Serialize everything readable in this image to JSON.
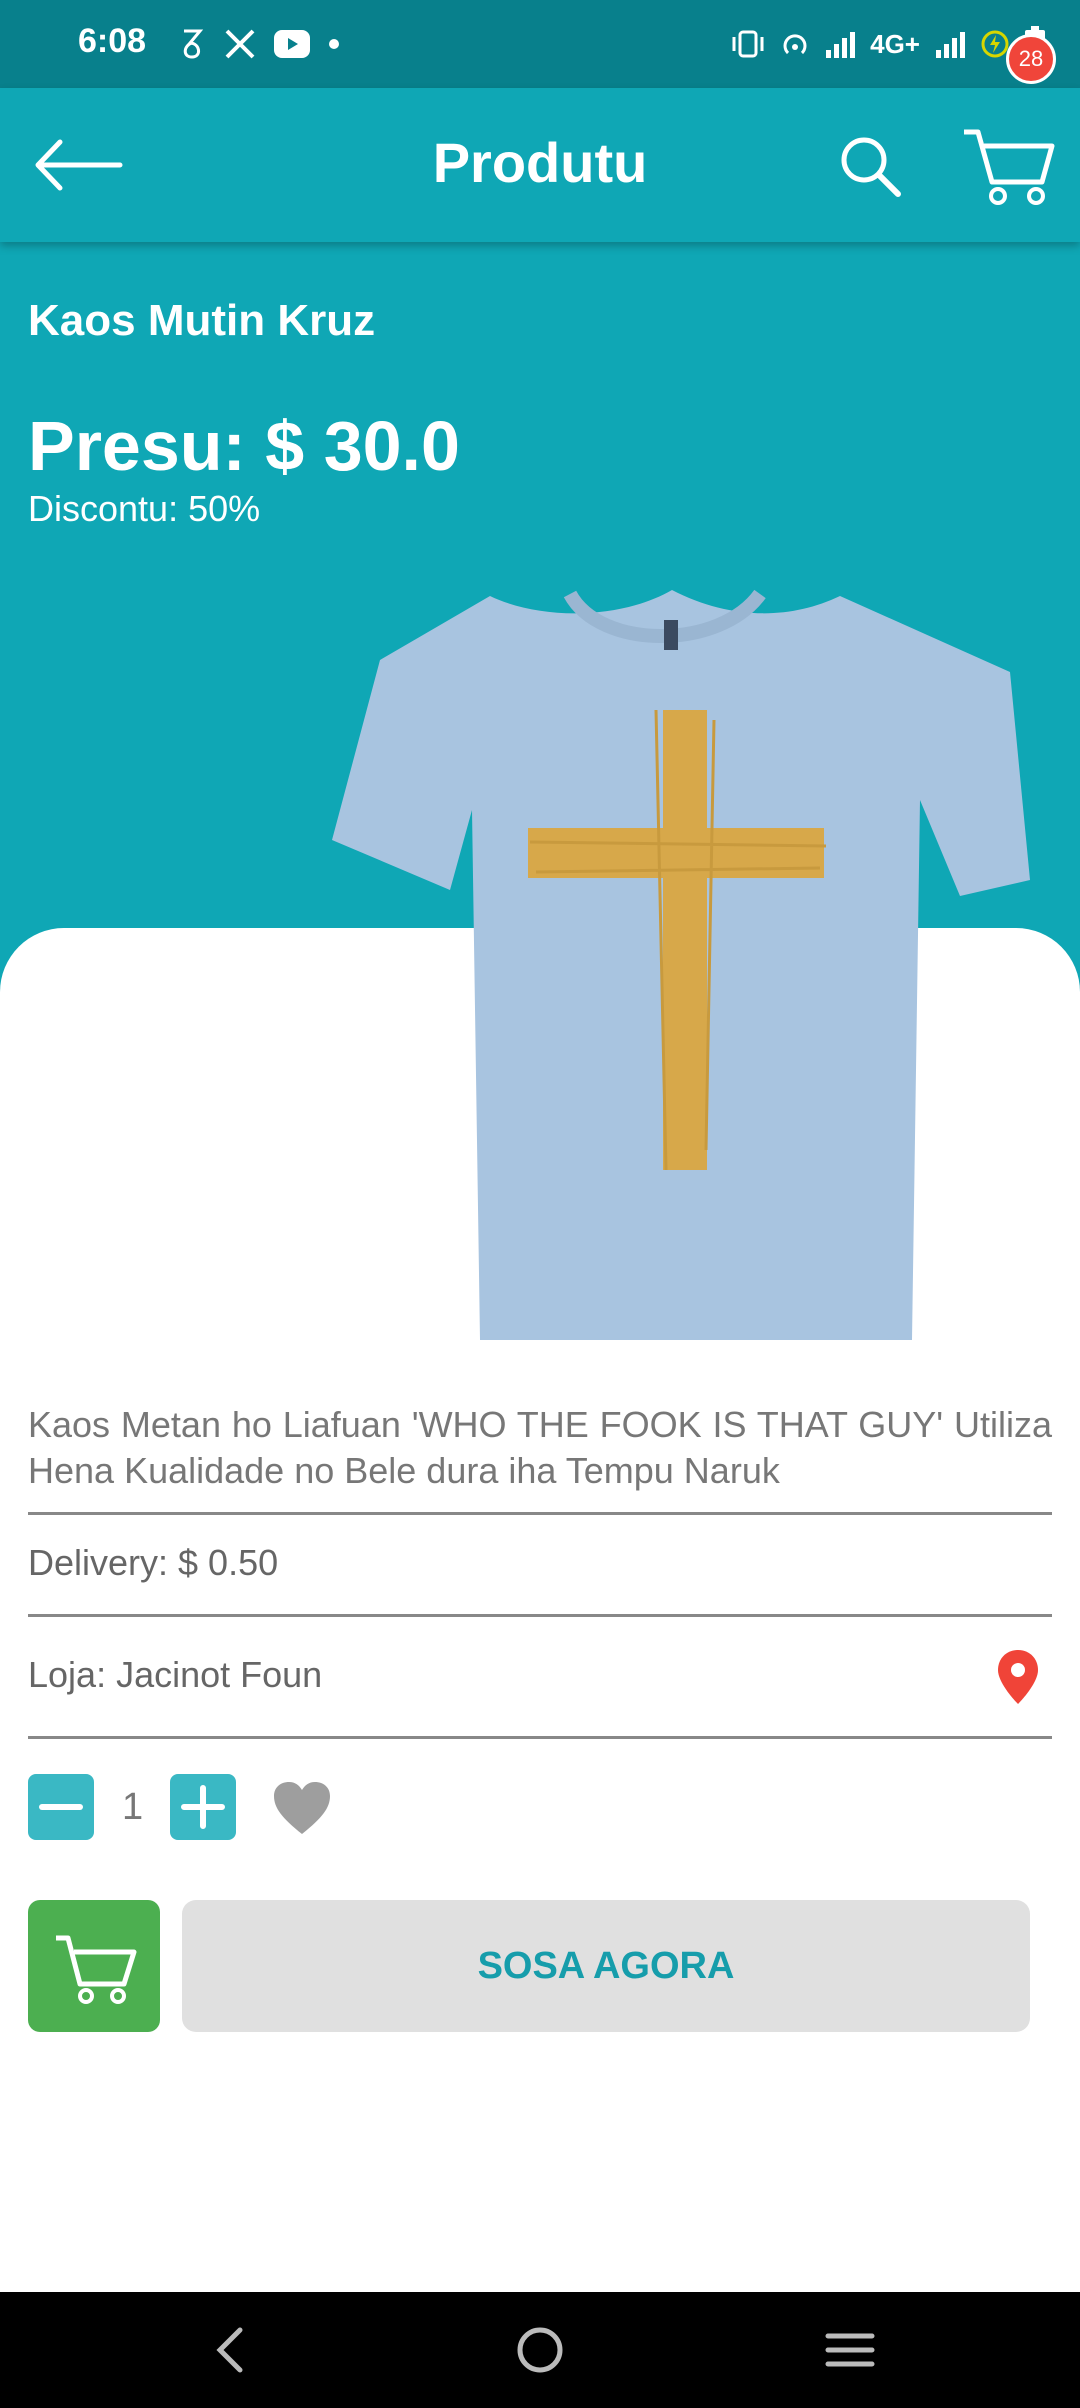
{
  "status_bar": {
    "time": "6:08",
    "left_icons": [
      "ens-icon",
      "x-icon",
      "youtube-icon",
      "dot-icon"
    ],
    "network": "4G+",
    "right_icons": [
      "vibrate-icon",
      "hotspot-icon",
      "signal-icon",
      "signal-icon-2",
      "battery-saver-icon",
      "battery-icon"
    ]
  },
  "app_bar": {
    "title": "Produtu",
    "cart_count": "28"
  },
  "product": {
    "name": "Kaos Mutin Kruz",
    "price": "Presu: $ 30.0",
    "discount": "Discontu: 50%",
    "description": "Kaos Metan ho Liafuan 'WHO THE FOOK IS THAT GUY' Utiliza Hena Kualidade no Bele dura iha Tempu Naruk",
    "delivery": "Delivery: $ 0.50",
    "store": "Loja: Jacinot Foun"
  },
  "quantity": {
    "value": "1"
  },
  "actions": {
    "buy_now_label": "SOSA AGORA"
  },
  "colors": {
    "primary": "#0fa7b5",
    "status_bar": "#08808c",
    "badge": "#f0453a",
    "cart_button": "#4caf50",
    "qty_buttons": "#3ab8c4",
    "buy_button_bg": "#e0e0e0",
    "buy_button_text": "#169dab"
  }
}
